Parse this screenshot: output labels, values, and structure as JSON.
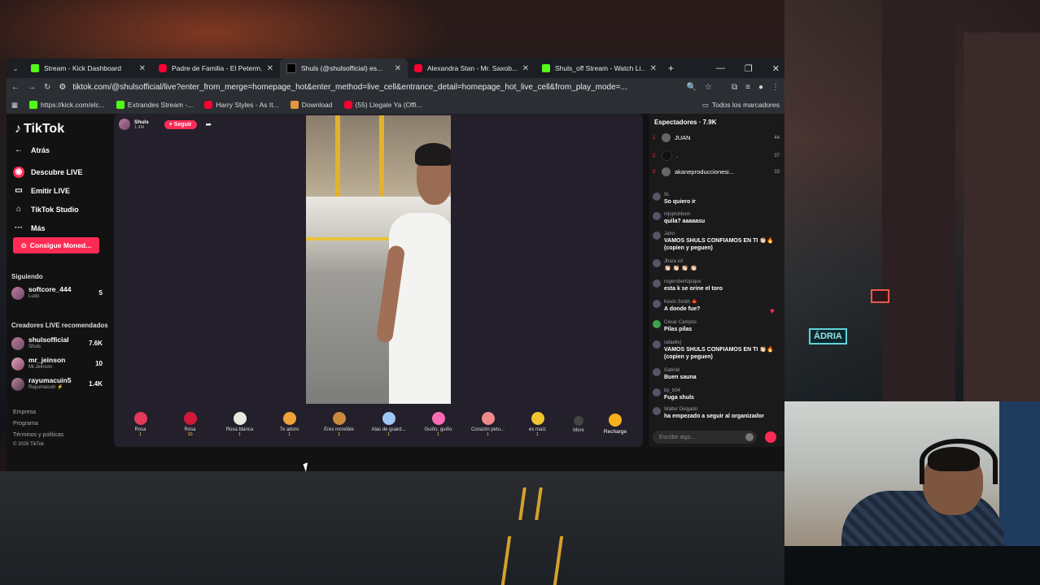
{
  "tabs": [
    {
      "title": "Stream - Kick Dashboard",
      "icon": "kick"
    },
    {
      "title": "Padre de Familia - El Peterm...",
      "icon": "youtube"
    },
    {
      "title": "Shuls (@shulsofficial) es...",
      "icon": "tiktok",
      "active": true
    },
    {
      "title": "Alexandra Stan - Mr. Saxob...",
      "icon": "youtube"
    },
    {
      "title": "Shuls_off Stream - Watch Li...",
      "icon": "kick"
    }
  ],
  "address": {
    "url": "tiktok.com/@shulsofficial/live?enter_from_merge=homepage_hot&enter_method=live_cell&entrance_detail=homepage_hot_live_cell&from_play_mode=..."
  },
  "bookmarks": [
    {
      "label": "https://kick.com/elc...",
      "icon": "kick"
    },
    {
      "label": "Extrandes Stream -...",
      "icon": "kick"
    },
    {
      "label": "Harry Styles - As It...",
      "icon": "youtube"
    },
    {
      "label": "Download",
      "icon": "download"
    },
    {
      "label": "(55) Llegale Ya (Offi...",
      "icon": "youtube"
    }
  ],
  "bookmarks_all": "Todos los marcadores",
  "nav": {
    "logo": "TikTok",
    "back": "Atrás",
    "discover": "Descubre LIVE",
    "go_live": "Emitir LIVE",
    "studio": "TikTok Studio",
    "more": "Más",
    "coins": "Consigue Moned..."
  },
  "following": {
    "title": "Siguiendo",
    "accounts": [
      {
        "name": "softcore_444",
        "sub": "Ludo",
        "count": "5"
      }
    ]
  },
  "recommended": {
    "title": "Creadores LIVE recomendados",
    "accounts": [
      {
        "name": "shulsofficial",
        "sub": "Shuls",
        "count": "7.6K"
      },
      {
        "name": "mr_jeinson",
        "sub": "Mr.Jeinson",
        "count": "10"
      },
      {
        "name": "rayumacuin5",
        "sub": "Rayumacuin ⚡",
        "count": "1.4K"
      }
    ]
  },
  "footer": {
    "company": "Empresa",
    "programs": "Programa",
    "terms": "Términos y políticas",
    "copyright": "© 2026 TikTok"
  },
  "host": {
    "name": "Shuls",
    "likes": "1.4M",
    "follow": "+ Seguir"
  },
  "gifts": [
    {
      "name": "Rosa",
      "price": "1",
      "color": "#e23a5a"
    },
    {
      "name": "Rosa",
      "price": "10",
      "color": "#d11a3a"
    },
    {
      "name": "Rosa blanca",
      "price": "1",
      "color": "#e8e8e0"
    },
    {
      "name": "Te adoro",
      "price": "1",
      "color": "#f0a23a"
    },
    {
      "name": "Eres increíble",
      "price": "1",
      "color": "#c98a3c"
    },
    {
      "name": "Alas de guard...",
      "price": "1",
      "color": "#9ec8f2"
    },
    {
      "name": "Guiño, guiño",
      "price": "1",
      "color": "#ff6bb3"
    },
    {
      "name": "Corazón petu...",
      "price": "1",
      "color": "#f08a8a"
    },
    {
      "name": "es maíz",
      "price": "1",
      "color": "#f2c531"
    }
  ],
  "more_label": "More",
  "recharge_label": "Recharge",
  "chat": {
    "viewers_label": "Espectadores · 7.9K",
    "top": [
      {
        "rank": "1",
        "name": "JUAN",
        "score": "44"
      },
      {
        "rank": "2",
        "name": ".",
        "score": "37"
      },
      {
        "rank": "3",
        "name": "akaneproduccionesi...",
        "score": "33"
      }
    ],
    "messages": [
      {
        "user": "IIL",
        "text": "So quiero ir"
      },
      {
        "user": "mjoptolibom",
        "text": "quila? aaaaasu"
      },
      {
        "user": "Jairo",
        "text": "VAMOS SHULS CONFIAMOS EN TI 👏🏻🔥 (copien y peguen)"
      },
      {
        "user": "Jhara xd",
        "text": "👏🏻 👏🏻 👏🏻 👏🏻"
      },
      {
        "user": "rogerobertopajue",
        "text": "esta k se orine el toro"
      },
      {
        "user": "Kevin Smith 🍁",
        "text": "A donde fue?"
      },
      {
        "user": "César Campos",
        "text": "Pilas pilas"
      },
      {
        "user": "rafaeltvj",
        "text": "VAMOS SHULS CONFIAMOS EN TI 👏🏻🔥 (copien y peguen)"
      },
      {
        "user": "Gabriel",
        "text": "Buen sauna"
      },
      {
        "user": "bp_b04",
        "text": "Fuga shuls"
      },
      {
        "user": "Walter Delgado",
        "text": "ha empezado a seguir al organizador"
      }
    ],
    "input_placeholder": "Escribe algo..."
  }
}
